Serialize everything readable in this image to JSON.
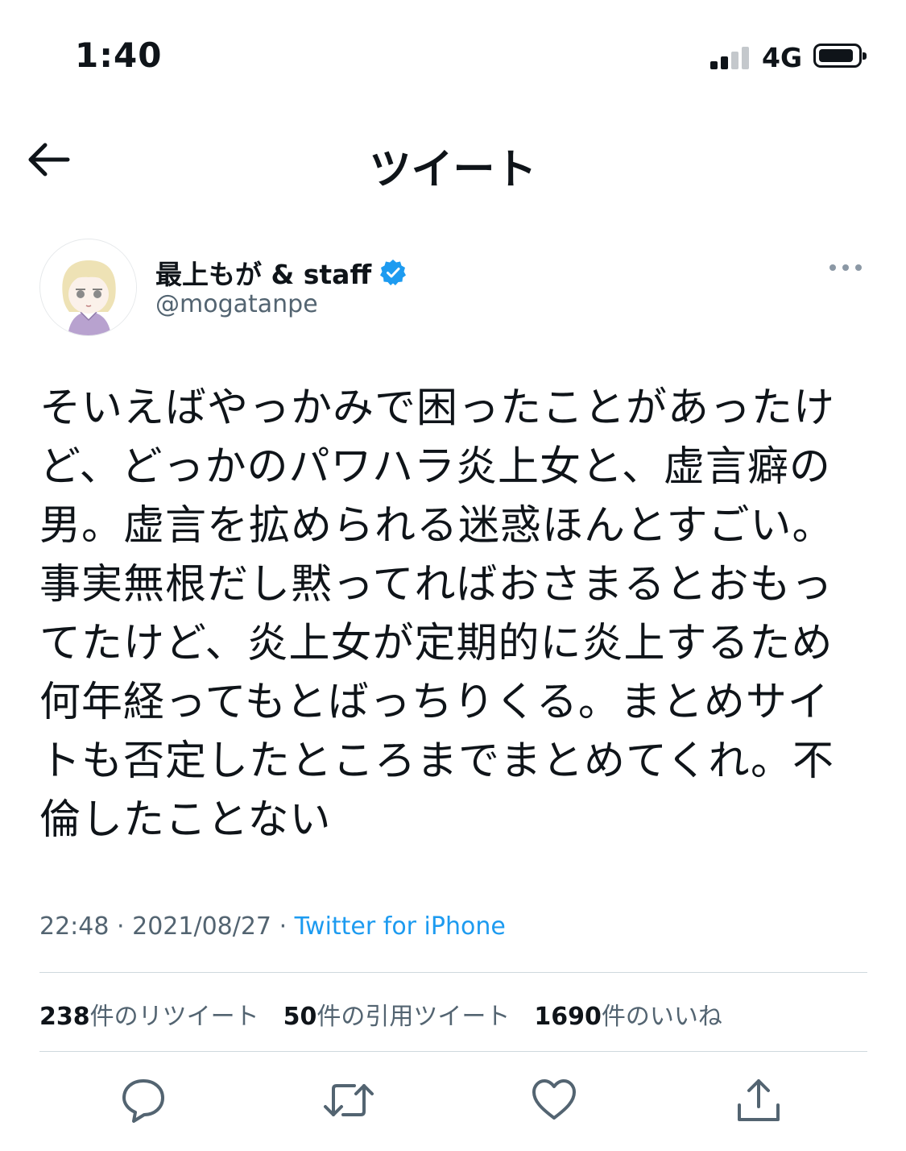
{
  "status_bar": {
    "time": "1:40",
    "network": "4G"
  },
  "nav": {
    "title": "ツイート",
    "back_icon": "arrow-left-icon"
  },
  "author": {
    "name": "最上もが & staff",
    "handle": "@mogatanpe",
    "verified_icon": "verified-badge-icon",
    "more_icon": "more-horizontal-icon"
  },
  "tweet": {
    "lines": [
      "そいえばやっかみで困ったことがあったけ",
      "ど、どっかのパワハラ炎上女と、虚言癖の",
      "男。虚言を拡められる迷惑ほんとすごい。",
      "事実無根だし黙ってればおさまるとおもっ",
      "てたけど、炎上女が定期的に炎上するため",
      "何年経ってもとばっちりくる。まとめサイ",
      "トも否定したところまでまとめてくれ。不",
      "倫したことない"
    ],
    "time": "22:48",
    "date": "2021/08/27",
    "separator": "·",
    "source": "Twitter for iPhone"
  },
  "stats": {
    "retweets": {
      "count": "238",
      "label": "件のリツイート"
    },
    "quotes": {
      "count": "50",
      "label": "件の引用ツイート"
    },
    "likes": {
      "count": "1690",
      "label": "件のいいね"
    }
  },
  "actions": [
    "reply-icon",
    "retweet-icon",
    "like-icon",
    "share-icon"
  ],
  "colors": {
    "accent": "#1d9bf0",
    "text": "#0f1419",
    "secondary": "#536471",
    "divider": "#cfd9de"
  }
}
